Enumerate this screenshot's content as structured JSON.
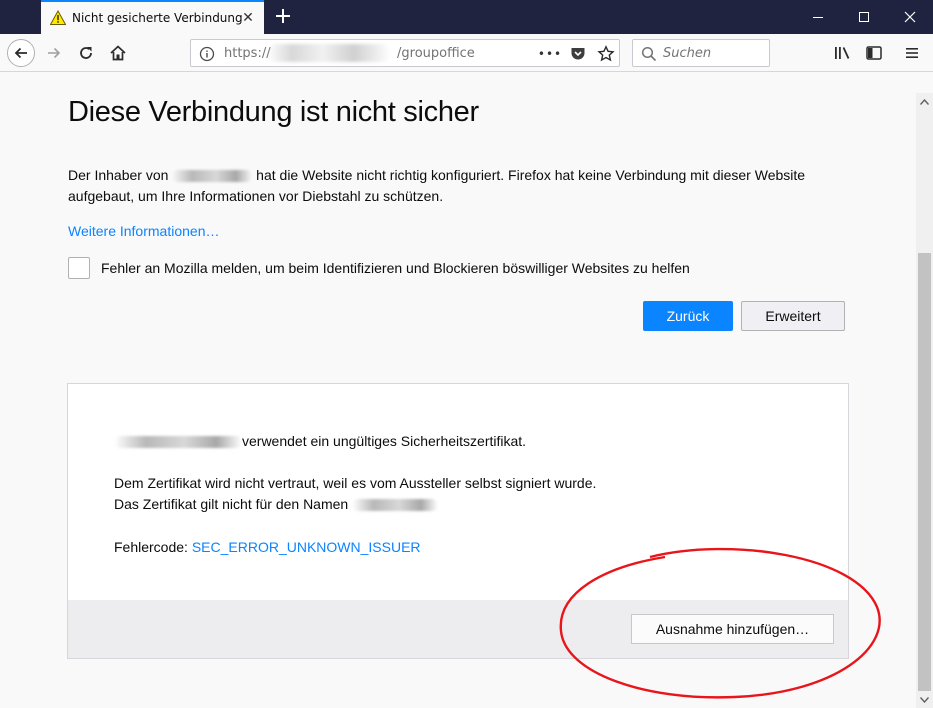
{
  "tab": {
    "title": "Nicht gesicherte Verbindung",
    "close_label": "✕"
  },
  "toolbar": {
    "url_prefix": "https://",
    "url_path": "/groupoffice",
    "page_actions_label": "•••",
    "search_placeholder": "Suchen"
  },
  "window_controls": [
    "minimize-icon",
    "maximize-icon",
    "close-icon"
  ],
  "page": {
    "heading": "Diese Verbindung ist nicht sicher",
    "desc_part1": "Der Inhaber von ",
    "desc_part2": " hat die Website nicht richtig konfiguriert. Firefox hat keine Verbindung mit dieser Website aufgebaut, um Ihre Informationen vor Diebstahl zu schützen.",
    "more_info_link": "Weitere Informationen…",
    "report_label": "Fehler an Mozilla melden, um beim Identifizieren und Blockieren böswilliger Websites zu helfen",
    "back_button": "Zurück",
    "advanced_button": "Erweitert"
  },
  "advanced_panel": {
    "line1_suffix": "verwendet ein ungültiges Sicherheitszertifikat.",
    "line2": "Dem Zertifikat wird nicht vertraut, weil es vom Aussteller selbst signiert wurde.",
    "line3": "Das Zertifikat gilt nicht für den Namen ",
    "error_code_label": "Fehlercode: ",
    "error_code": "SEC_ERROR_UNKNOWN_ISSUER",
    "add_exception_button": "Ausnahme hinzufügen…"
  },
  "colors": {
    "accent": "#0a84ff",
    "tabbar": "#202340",
    "annotation": "#e8151b"
  }
}
